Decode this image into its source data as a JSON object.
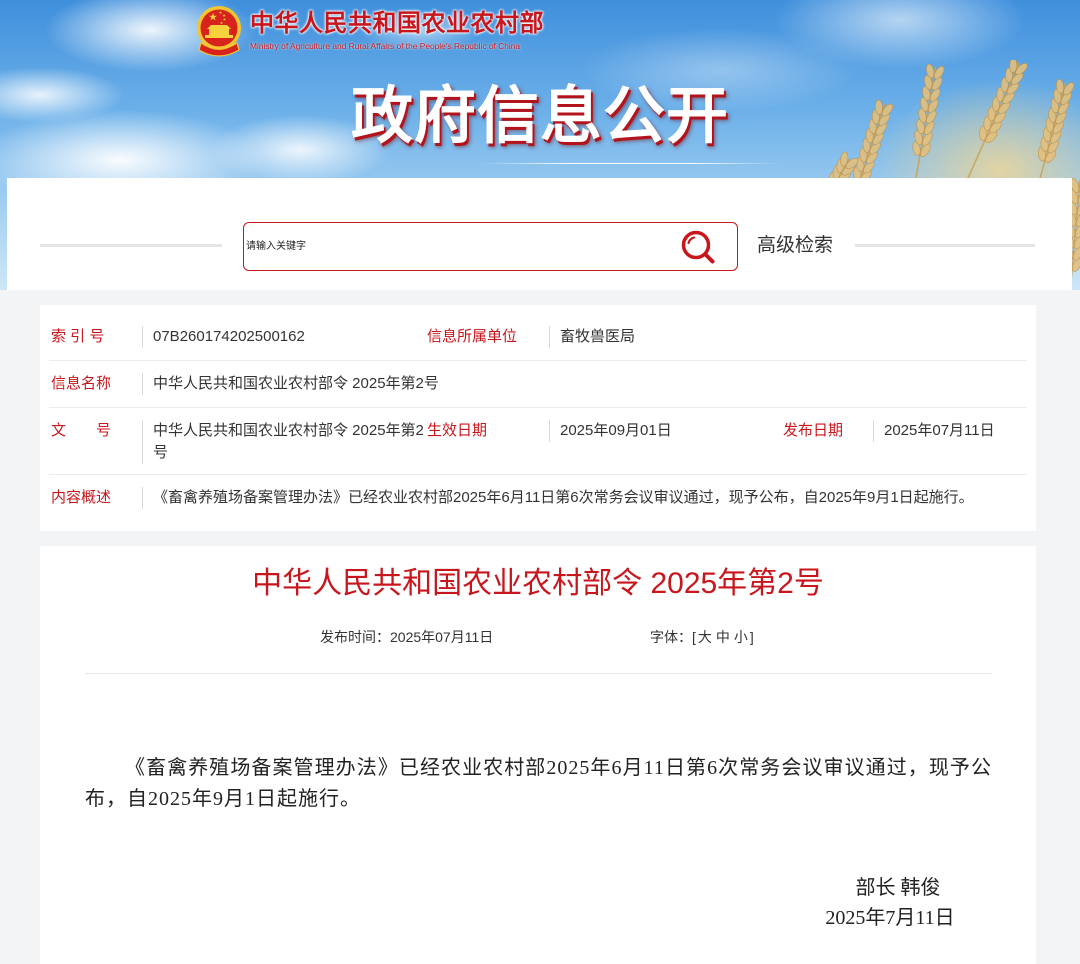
{
  "header": {
    "site_title": "中华人民共和国农业农村部",
    "site_subtitle": "Ministry of Agriculture and Rural Affairs of the People's Republic of China",
    "banner_title": "政府信息公开"
  },
  "search": {
    "placeholder": "请输入关键字",
    "advanced_label": "高级检索"
  },
  "info": {
    "index_label": "索 引 号",
    "index_value": "07B260174202500162",
    "unit_label": "信息所属单位",
    "unit_value": "畜牧兽医局",
    "name_label": "信息名称",
    "name_value": "中华人民共和国农业农村部令 2025年第2号",
    "doc_no_label": "文　　号",
    "doc_no_value": "中华人民共和国农业农村部令 2025年第2号",
    "effective_label": "生效日期",
    "effective_value": "2025年09月01日",
    "publish_label": "发布日期",
    "publish_value": "2025年07月11日",
    "summary_label": "内容概述",
    "summary_value": "《畜禽养殖场备案管理办法》已经农业农村部2025年6月11日第6次常务会议审议通过，现予公布，自2025年9月1日起施行。"
  },
  "article": {
    "title": "中华人民共和国农业农村部令 2025年第2号",
    "publish_time": "发布时间：2025年07月11日",
    "font_open": "字体：[",
    "font_sizes": [
      "大",
      "中",
      "小"
    ],
    "font_close": "]",
    "body": "《畜禽养殖场备案管理办法》已经农业农村部2025年6月11日第6次常务会议审议通过，现予公布，自2025年9月1日起施行。",
    "signature_title": "部长 韩俊",
    "signature_date": "2025年7月11日"
  },
  "icons": {
    "emblem": "national-emblem-icon",
    "search": "search-icon"
  },
  "colors": {
    "accent": "#c8161d",
    "text": "#333333",
    "sky": "#3f8fdc",
    "wheat": "#e3c07d",
    "page_background": "#f3f4f6"
  }
}
